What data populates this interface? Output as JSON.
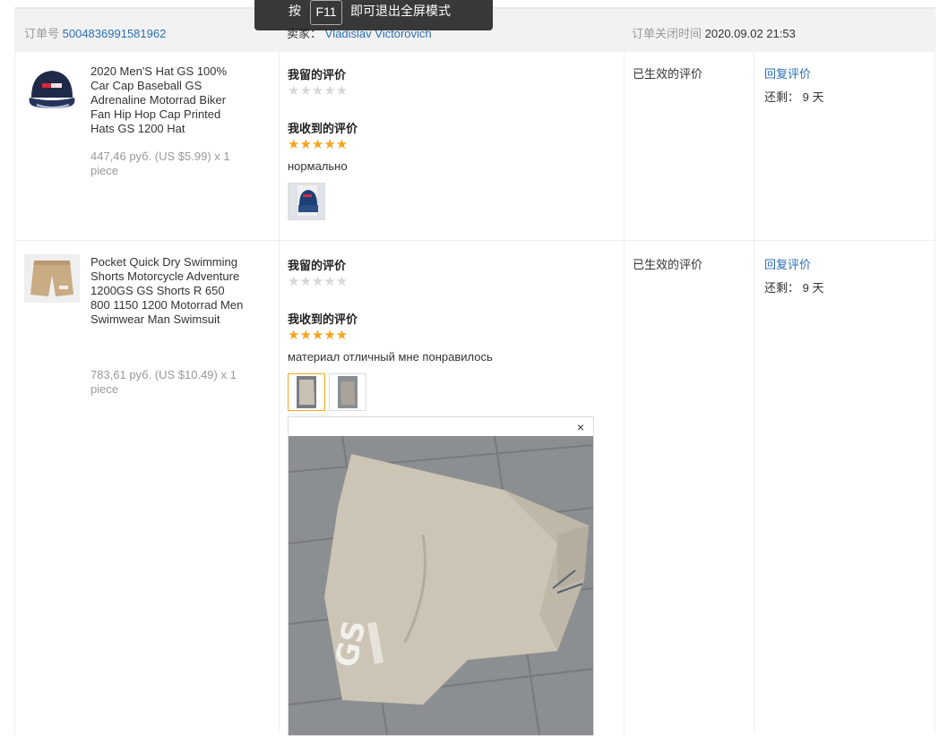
{
  "fullscreen_toast": {
    "prefix": "按",
    "key": "F11",
    "suffix": "即可退出全屏模式"
  },
  "order": {
    "number_label": "订单号",
    "number_value": "5004836991581962",
    "seller_label": "卖家：",
    "seller_value": "Vladislav Victorovich",
    "closed_label": "订单关闭时间",
    "closed_value": "2020.09.02 21:53"
  },
  "items": [
    {
      "title": "2020 Men'S Hat GS 100% Car Cap Baseball GS Adrenaline Motorrad Biker Fan Hip Hop Cap Printed Hats GS 1200 Hat",
      "price": "447,46 руб. (US $5.99) x 1 piece",
      "my_feedback_label": "我留的评价",
      "my_stars": 0,
      "received_label": "我收到的评价",
      "received_stars": 5,
      "received_text": "нормально",
      "photos": 1,
      "status": "已生效的评价",
      "reply_label": "回复评价",
      "remaining": "还剩： 9 天"
    },
    {
      "title": "Pocket Quick Dry Swimming Shorts Motorcycle Adventure 1200GS GS Shorts R 650 800 1150 1200 Motorrad Men Swimwear Man Swimsuit",
      "price": "783,61 руб. (US $10.49) x 1 piece",
      "my_feedback_label": "我留的评价",
      "my_stars": 0,
      "received_label": "我收到的评价",
      "received_stars": 5,
      "received_text": "материал отличный мне понравилось",
      "photos": 2,
      "status": "已生效的评价",
      "reply_label": "回复评价",
      "remaining": "还剩： 9 天"
    }
  ],
  "popup": {
    "close": "×",
    "print_text": "GS"
  },
  "icons": {
    "star": "★",
    "close": "close-icon"
  },
  "colors": {
    "link": "#2a6fb6",
    "star": "#f7a31b",
    "star_empty": "#d8d8d8"
  }
}
